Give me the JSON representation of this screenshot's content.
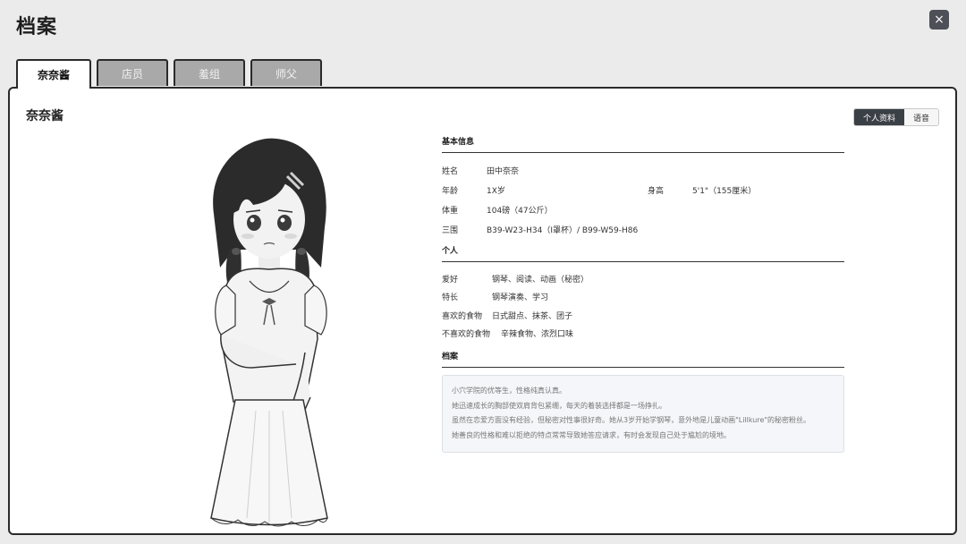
{
  "window": {
    "title": "档案",
    "close_icon": "×"
  },
  "tabs": [
    {
      "label": "奈奈酱",
      "active": true
    },
    {
      "label": "店员",
      "active": false
    },
    {
      "label": "羞组",
      "active": false
    },
    {
      "label": "师父",
      "active": false
    }
  ],
  "profile": {
    "name_header": "奈奈酱",
    "view_toggle": {
      "primary": "个人资料",
      "secondary": "语音"
    },
    "basic": {
      "heading": "基本信息",
      "name_label": "姓名",
      "name_value": "田中奈奈",
      "age_label": "年龄",
      "age_value": "1X岁",
      "height_label": "身高",
      "height_value": "5'1\"（155厘米）",
      "weight_label": "体重",
      "weight_value": "104磅（47公斤）",
      "measure_label": "三围",
      "measure_value": "B39-W23-H34（I罩杯）/ B99-W59-H86"
    },
    "personal": {
      "heading": "个人",
      "rows": [
        {
          "label": "爱好",
          "value": "钢琴、阅读、动画（秘密）"
        },
        {
          "label": "特长",
          "value": "钢琴演奏、学习"
        },
        {
          "label": "喜欢的食物",
          "value": "日式甜点、抹茶、团子"
        },
        {
          "label": "不喜欢的食物",
          "value": "辛辣食物、浓烈口味"
        }
      ]
    },
    "archive": {
      "heading": "档案",
      "lines": [
        "小穴学院的优等生，性格纯真认真。",
        "她迅速成长的胸部使双肩背包紧绷，每天的着装选择都是一场挣扎。",
        "虽然在恋爱方面没有经验，但秘密对性事很好奇。她从3岁开始学钢琴，意外地是儿童动画\"Lillkure\"的秘密粉丝。",
        "她善良的性格和难以拒绝的特点常常导致她答应请求，有时会发现自己处于尴尬的境地。"
      ]
    }
  }
}
